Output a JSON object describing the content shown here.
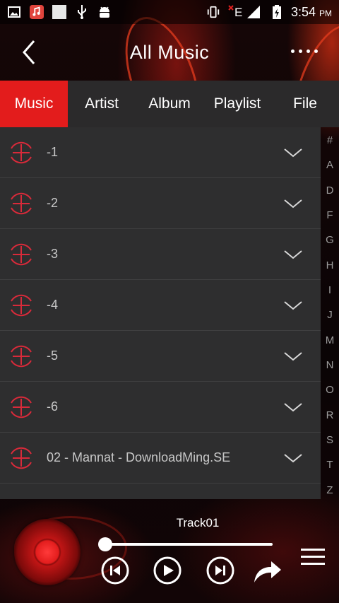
{
  "status_bar": {
    "time": "3:54",
    "ampm": "PM",
    "network": "E",
    "icons": [
      "image-icon",
      "music-app-icon",
      "blank-app-icon",
      "usb-icon",
      "android-debug-icon",
      "vibrate-icon",
      "signal-icon",
      "battery-charging-icon"
    ]
  },
  "header": {
    "title": "All Music"
  },
  "tabs": [
    {
      "label": "Music",
      "active": true
    },
    {
      "label": "Artist",
      "active": false
    },
    {
      "label": "Album",
      "active": false
    },
    {
      "label": "Playlist",
      "active": false
    },
    {
      "label": "File",
      "active": false
    }
  ],
  "songs": [
    {
      "title": "-1"
    },
    {
      "title": "-2"
    },
    {
      "title": "-3"
    },
    {
      "title": "-4"
    },
    {
      "title": "-5"
    },
    {
      "title": "-6"
    },
    {
      "title": "02 - Mannat - DownloadMing.SE"
    }
  ],
  "index_letters": [
    "#",
    "A",
    "D",
    "F",
    "G",
    "H",
    "I",
    "J",
    "M",
    "N",
    "O",
    "R",
    "S",
    "T",
    "Z"
  ],
  "player": {
    "track": "Track01",
    "progress": 0
  },
  "colors": {
    "accent": "#e31c1c",
    "list_bg": "#2e2e2f",
    "tab_bg": "#2b2a2b"
  }
}
